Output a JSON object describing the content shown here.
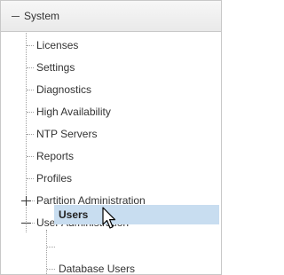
{
  "tree": {
    "root": {
      "label": "System",
      "expanded": true
    },
    "items": [
      {
        "label": "Licenses"
      },
      {
        "label": "Settings"
      },
      {
        "label": "Diagnostics"
      },
      {
        "label": "High Availability"
      },
      {
        "label": "NTP Servers"
      },
      {
        "label": "Reports"
      },
      {
        "label": "Profiles"
      },
      {
        "label": "Partition Administration",
        "expanded": false
      },
      {
        "label": "User Administration",
        "expanded": true
      }
    ],
    "user_admin_children": [
      {
        "label": "Users",
        "selected": true
      },
      {
        "label": "Database Users"
      }
    ]
  },
  "colors": {
    "selection": "#c8ddf0",
    "border": "#c8c8c8"
  },
  "icons": {
    "cursor": "mouse-pointer-icon"
  }
}
